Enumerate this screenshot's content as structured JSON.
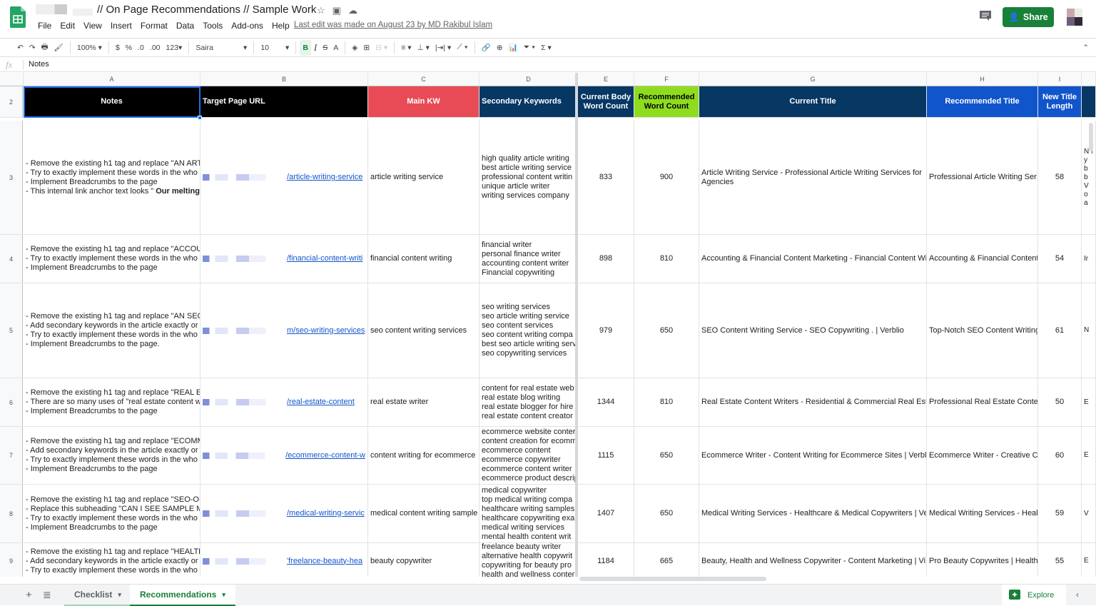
{
  "app": {
    "doc_title": "// On Page Recommendations // Sample Work",
    "menu": [
      "File",
      "Edit",
      "View",
      "Insert",
      "Format",
      "Data",
      "Tools",
      "Add-ons",
      "Help"
    ],
    "last_edit": "Last edit was made on August 23 by MD Rakibul Islam",
    "share_label": "Share",
    "brand_color": "#188038"
  },
  "toolbar": {
    "zoom": "100%",
    "currency": "$",
    "percent": "%",
    "dec_decrease": ".0",
    "dec_increase": ".00",
    "number_format": "123",
    "font": "Saira",
    "font_size": "10",
    "bold": "B",
    "italic": "I",
    "strike": "S",
    "text_color": "A",
    "function": "Σ"
  },
  "formula_bar": {
    "fx": "fx",
    "value": "Notes"
  },
  "columns": [
    "A",
    "B",
    "C",
    "D",
    "E",
    "F",
    "G",
    "H",
    "I"
  ],
  "header_row": {
    "number": "2",
    "cells": [
      {
        "label": "Notes",
        "bg": "#000000",
        "color": "#ffffff"
      },
      {
        "label": "Target Page URL",
        "bg": "#000000",
        "color": "#ffffff"
      },
      {
        "label": "Main KW",
        "bg": "#e94b56",
        "color": "#ffffff"
      },
      {
        "label": "Secondary Keywords",
        "bg": "#073763",
        "color": "#ffffff"
      },
      {
        "label": "Current Body Word Count",
        "bg": "#073763",
        "color": "#ffffff"
      },
      {
        "label": "Recommended Word Count",
        "bg": "#8fdc1e",
        "color": "#000000"
      },
      {
        "label": "Current Title",
        "bg": "#073763",
        "color": "#ffffff"
      },
      {
        "label": "Recommended Title",
        "bg": "#1155cc",
        "color": "#ffffff"
      },
      {
        "label": "New Title Length",
        "bg": "#1155cc",
        "color": "#ffffff"
      }
    ]
  },
  "rows": [
    {
      "number": "3",
      "notes": [
        "- Remove the existing h1 tag and replace \"AN ARTI",
        "- Try to exactly implement these words in the who",
        "- Implement Breadcrumbs to the page",
        "- This internal link anchor text looks \" Our melting"
      ],
      "url": "/article-writing-service",
      "main_kw": "article writing service",
      "secondary": [
        "high quality article writing",
        "best article writing service",
        "professional content writin",
        "unique article writer",
        "writing services company"
      ],
      "current_wc": "833",
      "recommended_wc": "900",
      "current_title": [
        "Article Writing Service - Professional Article Writing Services for",
        "Agencies"
      ],
      "recommended_title": "Professional Article Writing Ser",
      "title_len": "58",
      "next_col": "N f y b b V o a"
    },
    {
      "number": "4",
      "notes": [
        "- Remove the existing h1 tag and replace \"ACCOUN",
        "- Try to exactly implement these words in the who",
        "- Implement Breadcrumbs to the page"
      ],
      "url": "/financial-content-writi",
      "main_kw": "financial content writing",
      "secondary": [
        "financial writer",
        "personal finance writer",
        "accounting content writer",
        "Financial copywriting"
      ],
      "current_wc": "898",
      "recommended_wc": "810",
      "current_title": [
        "Accounting & Financial Content Marketing - Financial Content Wi"
      ],
      "recommended_title": "Accounting & Financial Content",
      "title_len": "54",
      "next_col": "Ir"
    },
    {
      "number": "5",
      "notes": [
        "- Remove the existing h1 tag and replace \"AN SEO",
        "- Add secondary keywords in the article exactly or",
        "- Try to exactly implement these words in the who",
        "- Implement Breadcrumbs to the page."
      ],
      "url": "m/seo-writing-services",
      "main_kw": "seo content writing services",
      "secondary": [
        "seo writing services",
        "seo article writing service",
        "seo content services",
        "seo content writing compa",
        "best seo article writing serv",
        "seo copywriting services"
      ],
      "current_wc": "979",
      "recommended_wc": "650",
      "current_title": [
        "SEO Content Writing Service - SEO Copywriting . | Verblio"
      ],
      "recommended_title": "Top-Notch SEO Content Writing",
      "title_len": "61",
      "next_col": "N"
    },
    {
      "number": "6",
      "notes": [
        "- Remove the existing h1 tag and replace \"REAL ES",
        "- There are so many uses of \"real estate content w",
        "- Implement Breadcrumbs to the page"
      ],
      "url": "/real-estate-content",
      "main_kw": "real estate writer",
      "secondary": [
        "content for real estate web",
        "real estate blog writing",
        "real estate blogger for hire",
        "real estate content creator"
      ],
      "current_wc": "1344",
      "recommended_wc": "810",
      "current_title": [
        "Real Estate Content Writers - Residential & Commercial Real Esta"
      ],
      "recommended_title": "Professional Real Estate Conte",
      "title_len": "50",
      "next_col": "E"
    },
    {
      "number": "7",
      "notes": [
        "- Remove the existing h1 tag and replace \"ECOMM",
        "- Add secondary keywords in the article exactly or",
        "- Try to exactly implement these words in the who",
        "- Implement Breadcrumbs to the page"
      ],
      "url": "/ecommerce-content-w",
      "main_kw": "content writing for ecommerce",
      "secondary": [
        "ecommerce website conter",
        "content creation for ecomm",
        "ecommerce content",
        "ecommerce copywriter",
        "ecommerce content writer",
        "ecommerce product descrip"
      ],
      "current_wc": "1115",
      "recommended_wc": "650",
      "current_title": [
        "Ecommerce Writer - Content Writing for Ecommerce Sites | Verbli"
      ],
      "recommended_title": "Ecommerce Writer - Creative Cc",
      "title_len": "60",
      "next_col": "E"
    },
    {
      "number": "8",
      "notes": [
        "- Remove the existing h1 tag and replace \"SEO-OP",
        "- Replace this subheading \"CAN I SEE SAMPLE ME",
        "- Try to exactly implement these words in the who",
        "- Implement Breadcrumbs to the page"
      ],
      "url": "/medical-writing-servic",
      "main_kw": "medical content writing sample",
      "secondary": [
        "medical copywriter",
        "top medical writing compa",
        "healthcare writing samples",
        "healthcare copywriting exa",
        "medical writing services",
        "mental health content writ"
      ],
      "current_wc": "1407",
      "recommended_wc": "650",
      "current_title": [
        "Medical Writing Services - Healthcare & Medical Copywriters | Ve"
      ],
      "recommended_title": "Medical Writing Services - Heal",
      "title_len": "59",
      "next_col": "V"
    },
    {
      "number": "9",
      "notes": [
        "- Remove the existing h1 tag and replace \"HEALTH",
        "- Add secondary keywords in the article exactly or",
        "- Try to exactly implement these words in the who"
      ],
      "url": "'freelance-beauty-hea",
      "main_kw": "beauty copywriter",
      "secondary": [
        "freelance beauty writer",
        "alternative health copywrit",
        "copywriting for beauty pro",
        "health and wellness conter"
      ],
      "current_wc": "1184",
      "recommended_wc": "665",
      "current_title": [
        "Beauty, Health and Wellness Copywriter - Content Marketing | Vi"
      ],
      "recommended_title": "Pro Beauty Copywrites | Health",
      "title_len": "55",
      "next_col": "E"
    }
  ],
  "sheet_tabs": [
    {
      "label": "Checklist",
      "active": false
    },
    {
      "label": "Recommendations",
      "active": true
    }
  ],
  "explore_label": "Explore"
}
